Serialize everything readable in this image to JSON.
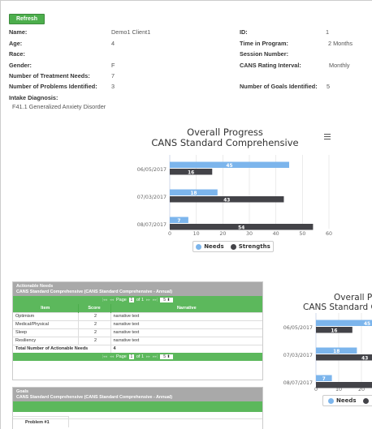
{
  "refresh_label": "Refresh",
  "client": {
    "name_label": "Name:",
    "name_value": "Demo1 Client1",
    "id_label": "ID:",
    "id_value": "1",
    "age_label": "Age:",
    "age_value": "4",
    "time_label": "Time in Program:",
    "time_value": "2 Months",
    "race_label": "Race:",
    "session_label": "Session Number:",
    "gender_label": "Gender:",
    "gender_value": "F",
    "rating_label": "CANS Rating Interval:",
    "rating_value": "Monthly",
    "needs_label": "Number of Treatment Needs:",
    "needs_value": "7",
    "problems_label": "Number of Problems Identified:",
    "problems_value": "3",
    "goals_label": "Number of Goals Identified:",
    "goals_value": "5",
    "diagnosis_label": "Intake Diagnosis:",
    "diagnosis_value": "F41.1 Generalized Anxiety Disorder"
  },
  "chart_main": {
    "title": "Overall Progress",
    "subtitle": "CANS Standard Comprehensive"
  },
  "chart_side": {
    "title": "Overall Pro",
    "subtitle": "CANS Standard Co"
  },
  "chart_data": [
    {
      "type": "bar",
      "title": "Overall Progress",
      "subtitle": "CANS Standard Comprehensive",
      "orientation": "horizontal",
      "categories": [
        "06/05/2017",
        "07/03/2017",
        "08/07/2017"
      ],
      "series": [
        {
          "name": "Needs",
          "values": [
            45,
            18,
            7
          ],
          "color": "#7cb5ec"
        },
        {
          "name": "Strengths",
          "values": [
            16,
            43,
            54
          ],
          "color": "#434348"
        }
      ],
      "xlim": [
        0,
        60
      ],
      "xticks": [
        "0",
        "10",
        "20",
        "30",
        "40",
        "50",
        "60"
      ],
      "grid": true,
      "legend": "bottom"
    },
    {
      "type": "bar",
      "title": "Overall Pro",
      "subtitle": "CANS Standard Co",
      "orientation": "horizontal",
      "categories": [
        "06/05/2017",
        "07/03/2017",
        "08/07/2017"
      ],
      "series": [
        {
          "name": "Needs",
          "values": [
            45,
            18,
            7
          ],
          "color": "#7cb5ec"
        },
        {
          "name": "Strengths",
          "values": [
            16,
            43,
            54
          ],
          "color": "#434348"
        }
      ],
      "xlim": [
        0,
        60
      ],
      "xticks": [
        "0",
        "10",
        "20"
      ],
      "grid": true,
      "legend": "bottom"
    }
  ],
  "actionable": {
    "header_line1": "Actionable Needs",
    "header_line2": "CANS Standard Comprehensive (CANS Standard Comprehensive - Annual)",
    "pager": {
      "page_label": "Page",
      "page_value": "1",
      "of_label": "of 1",
      "size_value": "5"
    },
    "columns": [
      "Item",
      "Score",
      "Narrative"
    ],
    "rows": [
      {
        "item": "Optimism",
        "score": "2",
        "narrative": "narrative text"
      },
      {
        "item": "Medical/Physical",
        "score": "2",
        "narrative": "narrative text"
      },
      {
        "item": "Sleep",
        "score": "2",
        "narrative": "narrative text"
      },
      {
        "item": "Resiliency",
        "score": "2",
        "narrative": "narrative text"
      }
    ],
    "total_label": "Total Number of Actionable Needs",
    "total_value": "4"
  },
  "goals": {
    "header_line1": "Goals",
    "header_line2": "CANS Standard Comprehensive (CANS Standard Comprehensive - Annual)",
    "problem_label": "Problem #1"
  },
  "legend": {
    "needs": "Needs",
    "strengths": "Strengths"
  },
  "colors": {
    "needs": "#7cb5ec",
    "strengths": "#434348",
    "green": "#5cb85c",
    "header_gray": "#a9a9a9"
  }
}
